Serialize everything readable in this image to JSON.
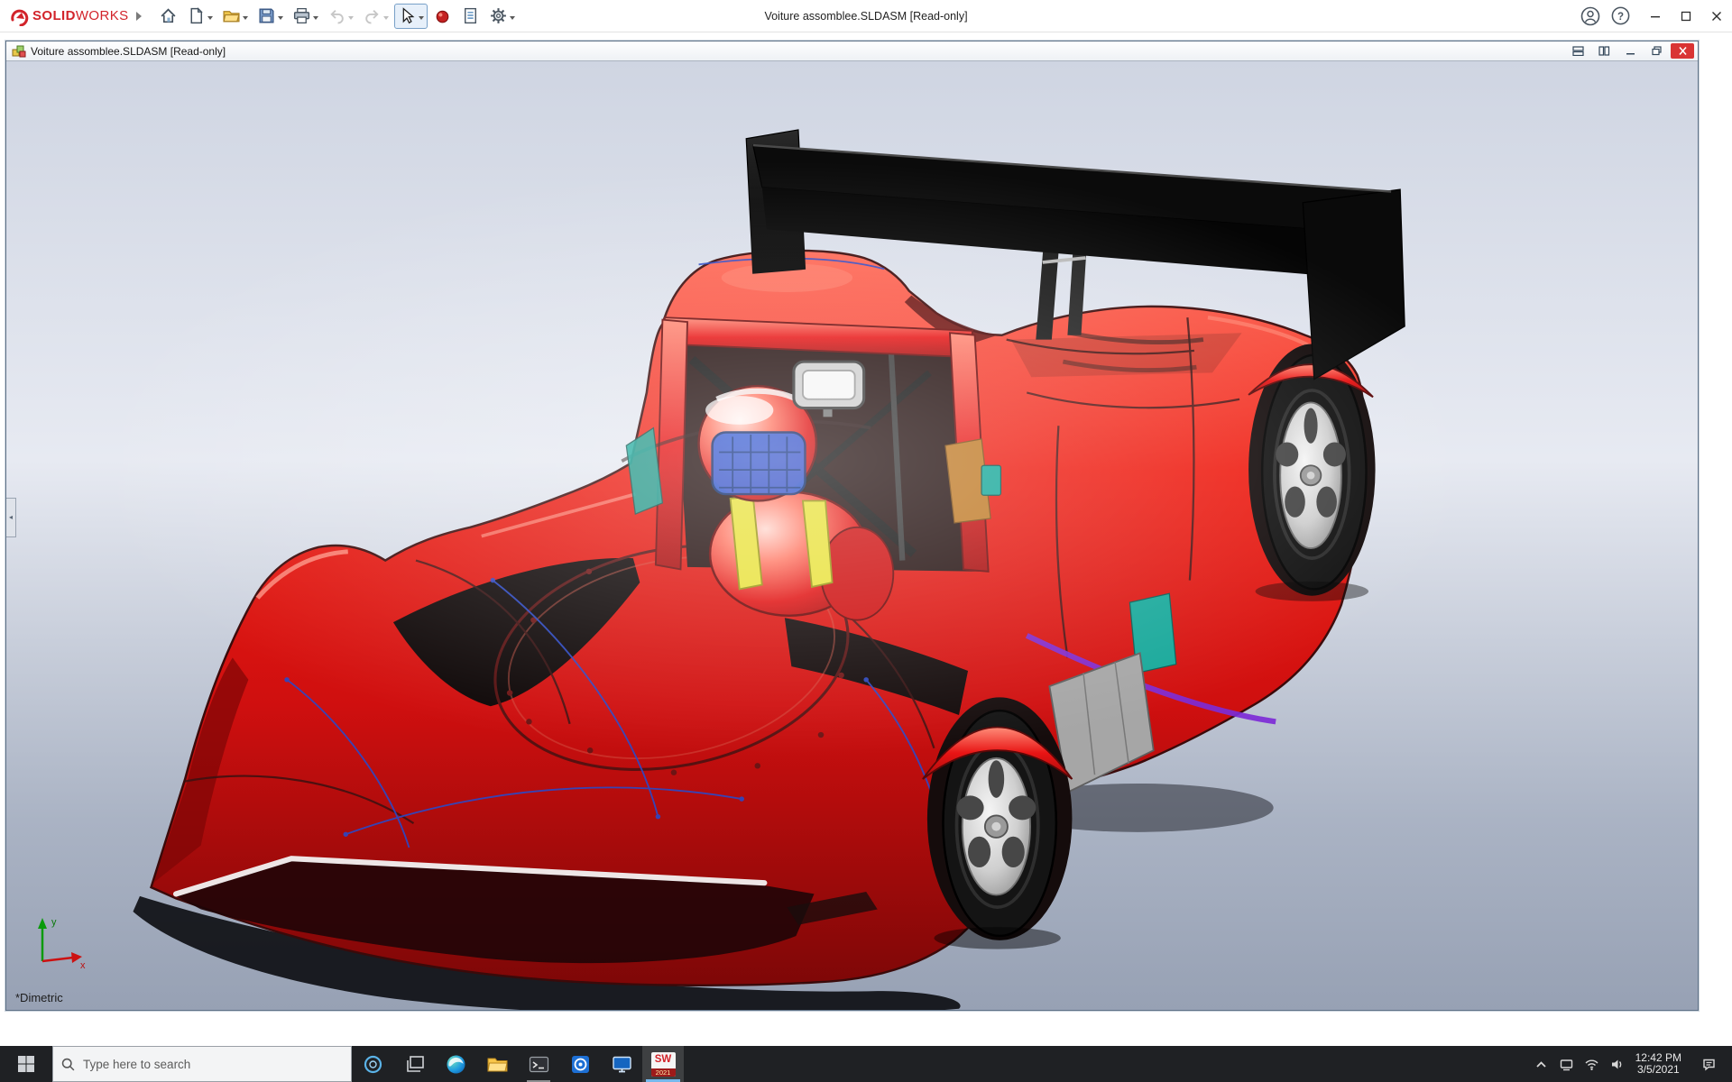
{
  "app": {
    "title": "Voiture assomblee.SLDASM [Read-only]",
    "brand": {
      "solid": "SOLID",
      "works": "WORKS"
    },
    "toolbar_icons": [
      "home-icon",
      "new-document-icon",
      "open-folder-icon",
      "save-icon",
      "print-icon",
      "undo-icon",
      "redo-icon",
      "select-arrow-icon",
      "red-sphere-icon",
      "file-properties-icon",
      "options-gear-icon"
    ],
    "window_icons": [
      "account-icon",
      "help-icon",
      "minimize-icon",
      "maximize-icon",
      "close-icon"
    ]
  },
  "document_window": {
    "title": "Voiture assomblee.SLDASM [Read-only]",
    "button_icons": [
      "tile-horizontal-icon",
      "tile-vertical-icon",
      "doc-minimize-icon",
      "doc-restore-icon",
      "doc-close-icon"
    ]
  },
  "viewport": {
    "view_orientation_label": "*Dimetric",
    "triad": {
      "x_label": "x",
      "y_label": "y"
    }
  },
  "taskbar": {
    "search_placeholder": "Type here to search",
    "clock": {
      "time": "12:42 PM",
      "date": "3/5/2021"
    },
    "app_icons": [
      "start-icon",
      "search-icon",
      "cortana-icon",
      "task-view-icon",
      "edge-icon",
      "file-explorer-icon",
      "terminal-app-icon",
      "media-app-icon",
      "display-app-icon",
      "solidworks-app-icon"
    ],
    "tray_icons": [
      "hidden-icons-chevron-icon",
      "network-icon",
      "wifi-icon",
      "volume-icon",
      "notification-center-icon"
    ],
    "solidworks_badge": {
      "line1": "SW",
      "line2": "2021"
    }
  },
  "colors": {
    "body_red": "#e01212",
    "body_red_dark": "#8e0808",
    "body_red_light": "#ff5d4d",
    "wing_black": "#0b0b0b",
    "rim_silver": "#c9c9c9",
    "visor_blue": "#2e5bd8",
    "harness_yellow": "#e9e23d",
    "glass_teal": "#17a89a",
    "panel_orange": "#c07b28",
    "stripe_purple": "#7d2bd6",
    "viewport_top": "#cfd5e2",
    "viewport_bottom": "#97a1b4",
    "taskbar_bg": "#1f2124",
    "close_red": "#d93434",
    "brand_red": "#d2232a"
  }
}
